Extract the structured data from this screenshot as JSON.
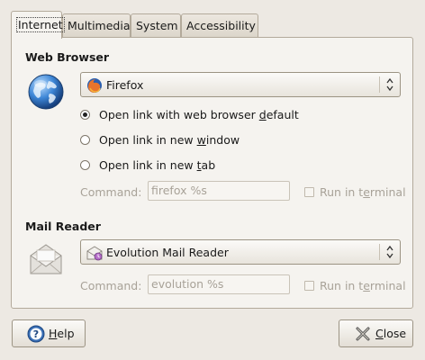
{
  "tabs": [
    {
      "label": "Internet",
      "active": true
    },
    {
      "label": "Multimedia",
      "active": false
    },
    {
      "label": "System",
      "active": false
    },
    {
      "label": "Accessibility",
      "active": false
    }
  ],
  "web_browser": {
    "title": "Web Browser",
    "icon": "globe-icon",
    "selected": "Firefox",
    "selected_icon": "firefox-icon",
    "options": [
      {
        "label_pre": "Open link with web browser ",
        "label_u": "d",
        "label_post": "efault",
        "checked": true
      },
      {
        "label_pre": "Open link in new ",
        "label_u": "w",
        "label_post": "indow",
        "checked": false
      },
      {
        "label_pre": "Open link in new ",
        "label_u": "t",
        "label_post": "ab",
        "checked": false
      }
    ],
    "command_label": "Command:",
    "command_value": "firefox %s",
    "terminal_pre": "Run in t",
    "terminal_u": "e",
    "terminal_post": "rminal",
    "terminal_checked": false
  },
  "mail_reader": {
    "title": "Mail Reader",
    "icon": "mail-envelope-icon",
    "selected": "Evolution Mail Reader",
    "selected_icon": "evolution-icon",
    "command_label": "Command:",
    "command_value": "evolution %s",
    "terminal_pre": "Run in t",
    "terminal_u": "e",
    "terminal_post": "rminal",
    "terminal_checked": false
  },
  "buttons": {
    "help_u": "H",
    "help_rest": "elp",
    "close_u": "C",
    "close_rest": "lose"
  },
  "colors": {
    "window_bg": "#ede9e3",
    "panel_bg": "#f5f3ef",
    "disabled_text": "#a8a298"
  }
}
